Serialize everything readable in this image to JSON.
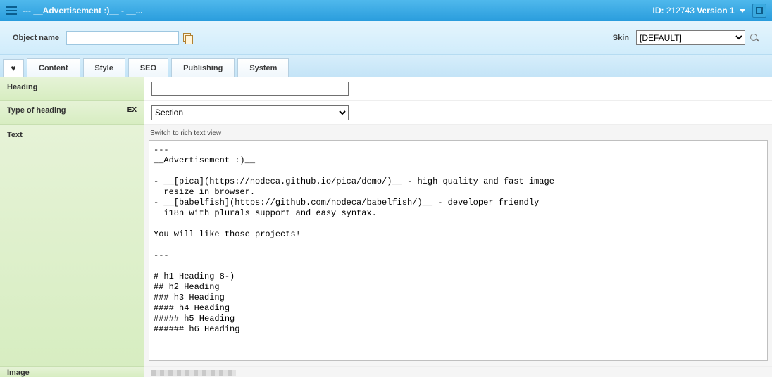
{
  "titlebar": {
    "title": "--- __Advertisement :)__ - __...",
    "id_label": "ID:",
    "id_value": "212743",
    "version_label": "Version 1"
  },
  "toolbar": {
    "object_name_label": "Object name",
    "object_name_value": "",
    "skin_label": "Skin",
    "skin_value": "[DEFAULT]",
    "skin_options": [
      "[DEFAULT]"
    ]
  },
  "tabs": {
    "items": [
      {
        "label": "Content"
      },
      {
        "label": "Style"
      },
      {
        "label": "SEO"
      },
      {
        "label": "Publishing"
      },
      {
        "label": "System"
      }
    ]
  },
  "form": {
    "heading_label": "Heading",
    "heading_value": "",
    "type_label": "Type of heading",
    "type_badge": "EX",
    "type_value": "Section",
    "type_options": [
      "Section"
    ],
    "text_label": "Text",
    "switch_link": "Switch to rich text view",
    "text_value": "---\n__Advertisement :)__\n\n- __[pica](https://nodeca.github.io/pica/demo/)__ - high quality and fast image\n  resize in browser.\n- __[babelfish](https://github.com/nodeca/babelfish/)__ - developer friendly\n  i18n with plurals support and easy syntax.\n\nYou will like those projects!\n\n---\n\n# h1 Heading 8-)\n## h2 Heading\n### h3 Heading\n#### h4 Heading\n##### h5 Heading\n###### h6 Heading",
    "image_label": "Image"
  }
}
